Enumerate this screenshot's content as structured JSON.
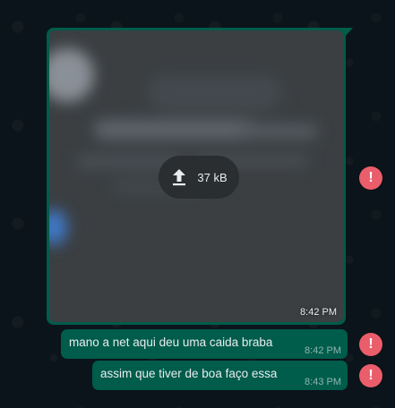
{
  "messages": [
    {
      "type": "image",
      "upload_size": "37 kB",
      "time": "8:42 PM",
      "upload_icon": "upload-arrow-icon",
      "status_icon": "error-exclamation-icon"
    },
    {
      "type": "text",
      "text": "mano a net aqui deu uma caida braba",
      "time": "8:42 PM",
      "status_icon": "error-exclamation-icon"
    },
    {
      "type": "text",
      "text": "assim que tiver de boa faço essa",
      "time": "8:43 PM",
      "status_icon": "error-exclamation-icon"
    }
  ],
  "error_badge_glyph": "!",
  "colors": {
    "background": "#0b141a",
    "outgoing_bubble": "#005c4b",
    "error_badge": "#ea5d6a",
    "text": "#e9edef"
  }
}
